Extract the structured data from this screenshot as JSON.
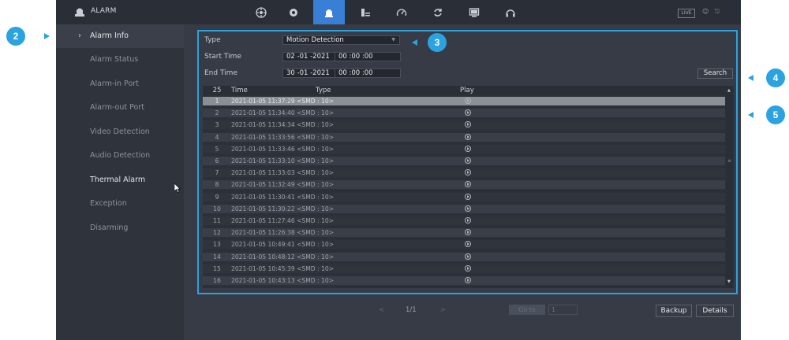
{
  "app": {
    "title": "ALARM",
    "live_label": "LIVE"
  },
  "topbar_icons": [
    "overview-icon",
    "settings-icon",
    "alarm-icon",
    "storage-icon",
    "performance-icon",
    "backup-icon",
    "display-icon",
    "headset-icon"
  ],
  "sidebar": {
    "items": [
      {
        "label": "Alarm Info",
        "selected": true
      },
      {
        "label": "Alarm Status"
      },
      {
        "label": "Alarm-in Port"
      },
      {
        "label": "Alarm-out Port"
      },
      {
        "label": "Video Detection"
      },
      {
        "label": "Audio Detection"
      },
      {
        "label": "Thermal Alarm",
        "highlighted": true
      },
      {
        "label": "Exception"
      },
      {
        "label": "Disarming"
      }
    ]
  },
  "filter": {
    "type_label": "Type",
    "type_value": "Motion Detection",
    "start_label": "Start Time",
    "start_date": "02 -01 -2021",
    "start_time": "00 :00 :00",
    "end_label": "End Time",
    "end_date": "30 -01 -2021",
    "end_time": "00 :00 :00",
    "search_label": "Search"
  },
  "table": {
    "count": "25",
    "headers": {
      "time": "Time",
      "type": "Type",
      "play": "Play"
    },
    "rows": [
      {
        "n": "1",
        "text": "2021-01-05 11:37:29  <SMD : 10>"
      },
      {
        "n": "2",
        "text": "2021-01-05 11:34:40  <SMD : 10>"
      },
      {
        "n": "3",
        "text": "2021-01-05 11:34:34  <SMD : 10>"
      },
      {
        "n": "4",
        "text": "2021-01-05 11:33:56  <SMD : 10>"
      },
      {
        "n": "5",
        "text": "2021-01-05 11:33:46  <SMD : 10>"
      },
      {
        "n": "6",
        "text": "2021-01-05 11:33:10  <SMD : 10>"
      },
      {
        "n": "7",
        "text": "2021-01-05 11:33:03  <SMD : 10>"
      },
      {
        "n": "8",
        "text": "2021-01-05 11:32:49  <SMD : 10>"
      },
      {
        "n": "9",
        "text": "2021-01-05 11:30:41  <SMD : 10>"
      },
      {
        "n": "10",
        "text": "2021-01-05 11:30:22  <SMD : 10>"
      },
      {
        "n": "11",
        "text": "2021-01-05 11:27:46  <SMD : 10>"
      },
      {
        "n": "12",
        "text": "2021-01-05 11:26:38  <SMD : 10>"
      },
      {
        "n": "13",
        "text": "2021-01-05 10:49:41  <SMD : 10>"
      },
      {
        "n": "14",
        "text": "2021-01-05 10:48:12  <SMD : 10>"
      },
      {
        "n": "15",
        "text": "2021-01-05 10:45:39  <SMD : 10>"
      },
      {
        "n": "16",
        "text": "2021-01-05 10:43:13  <SMD : 10>"
      }
    ]
  },
  "pager": {
    "prev": "<",
    "page": "1/1",
    "next": ">",
    "goto_label": "Go to",
    "page_input": "1"
  },
  "actions": {
    "backup_label": "Backup",
    "details_label": "Details"
  },
  "callouts": [
    "2",
    "3",
    "4",
    "5"
  ],
  "colors": {
    "accent": "#2aa3e0",
    "active_tab": "#3a7fd6",
    "background": "#363b45"
  }
}
